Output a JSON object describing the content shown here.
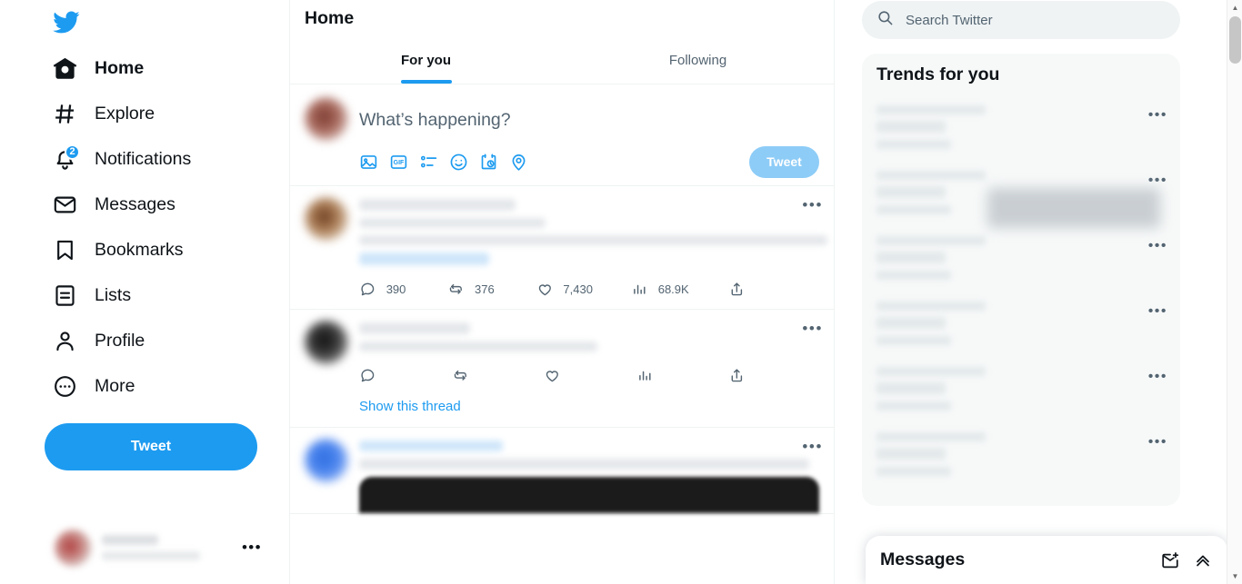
{
  "sidebar": {
    "logo_icon": "twitter-bird-icon",
    "items": [
      {
        "label": "Home",
        "icon": "home-icon",
        "active": true
      },
      {
        "label": "Explore",
        "icon": "hashtag-icon",
        "active": false
      },
      {
        "label": "Notifications",
        "icon": "bell-icon",
        "badge": "2",
        "active": false
      },
      {
        "label": "Messages",
        "icon": "envelope-icon",
        "active": false
      },
      {
        "label": "Bookmarks",
        "icon": "bookmark-icon",
        "active": false
      },
      {
        "label": "Lists",
        "icon": "list-icon",
        "active": false
      },
      {
        "label": "Profile",
        "icon": "person-icon",
        "active": false
      },
      {
        "label": "More",
        "icon": "more-circle-icon",
        "active": false
      }
    ],
    "tweet_button_label": "Tweet",
    "account_more_icon": "more-dots-icon",
    "account_more_label": "•••"
  },
  "center": {
    "title": "Home",
    "tabs": [
      {
        "label": "For you",
        "active": true
      },
      {
        "label": "Following",
        "active": false
      }
    ],
    "composer": {
      "placeholder": "What’s happening?",
      "tweet_button_label": "Tweet",
      "icons": [
        "image-icon",
        "gif-icon",
        "poll-icon",
        "emoji-icon",
        "schedule-icon",
        "location-icon"
      ]
    },
    "tweets": [
      {
        "avatar": "brown",
        "more_label": "•••",
        "redacted": true,
        "actions": [
          {
            "icon": "reply-icon",
            "count": "390"
          },
          {
            "icon": "retweet-icon",
            "count": "376"
          },
          {
            "icon": "like-icon",
            "count": "7,430"
          },
          {
            "icon": "views-icon",
            "count": "68.9K"
          },
          {
            "icon": "share-icon",
            "count": ""
          }
        ]
      },
      {
        "avatar": "dark",
        "more_label": "•••",
        "redacted": true,
        "actions": [
          {
            "icon": "reply-icon",
            "count": ""
          },
          {
            "icon": "retweet-icon",
            "count": ""
          },
          {
            "icon": "like-icon",
            "count": ""
          },
          {
            "icon": "views-icon",
            "count": ""
          },
          {
            "icon": "share-icon",
            "count": ""
          }
        ],
        "show_thread_label": "Show this thread"
      },
      {
        "avatar": "blue",
        "more_label": "•••",
        "redacted": true,
        "has_media": true
      }
    ]
  },
  "right": {
    "search": {
      "placeholder": "Search Twitter",
      "icon": "search-icon",
      "value": ""
    },
    "trends": {
      "title": "Trends for you",
      "items": [
        {
          "more_label": "•••"
        },
        {
          "more_label": "•••"
        },
        {
          "more_label": "•••"
        },
        {
          "more_label": "•••"
        },
        {
          "more_label": "•••"
        },
        {
          "more_label": "•••"
        }
      ]
    },
    "dock": {
      "title": "Messages",
      "new_message_icon": "new-message-icon",
      "expand_icon": "chevron-up-icon"
    }
  },
  "browser": {
    "scroll_up_label": "▲",
    "scroll_down_label": "▼"
  },
  "colors": {
    "accent": "#1d9bf0",
    "text": "#0f1419",
    "muted": "#536471",
    "border": "#eff3f4",
    "panel": "#f7f9f9"
  }
}
